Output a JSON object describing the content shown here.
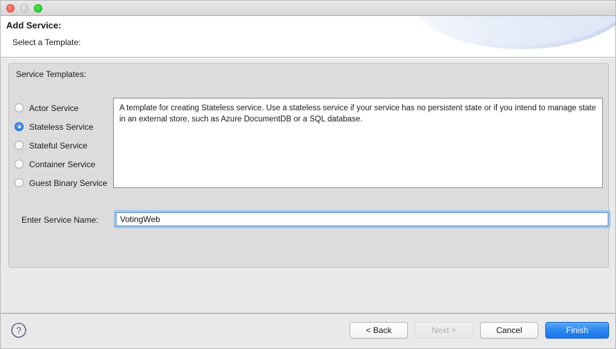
{
  "window": {
    "traffic_lights": [
      "close",
      "minimize",
      "zoom"
    ]
  },
  "header": {
    "title": "Add Service:",
    "subtitle": "Select a Template:"
  },
  "panel": {
    "title": "Service Templates:",
    "templates": [
      {
        "label": "Actor Service",
        "selected": false
      },
      {
        "label": "Stateless Service",
        "selected": true
      },
      {
        "label": "Stateful Service",
        "selected": false
      },
      {
        "label": "Container Service",
        "selected": false
      },
      {
        "label": "Guest Binary Service",
        "selected": false
      }
    ],
    "description": "A template for creating Stateless service.  Use a stateless service if your service has no persistent state or if you intend to manage state in an external store, such as Azure DocumentDB or a SQL database."
  },
  "service_name": {
    "label": "Enter Service Name:",
    "value": "VotingWeb",
    "placeholder": ""
  },
  "footer": {
    "help_icon": "question-mark-icon",
    "buttons": [
      {
        "label": "< Back",
        "kind": "normal",
        "disabled": false
      },
      {
        "label": "Next >",
        "kind": "normal",
        "disabled": true
      },
      {
        "label": "Cancel",
        "kind": "normal",
        "disabled": false
      },
      {
        "label": "Finish",
        "kind": "primary",
        "disabled": false
      }
    ]
  },
  "colors": {
    "accent_blue": "#2b86f0",
    "radio_selected": "#2f7de0",
    "focus_ring": "#9fc4ef",
    "panel_bg": "#dcdcdc",
    "body_bg": "#e9e9e9"
  }
}
